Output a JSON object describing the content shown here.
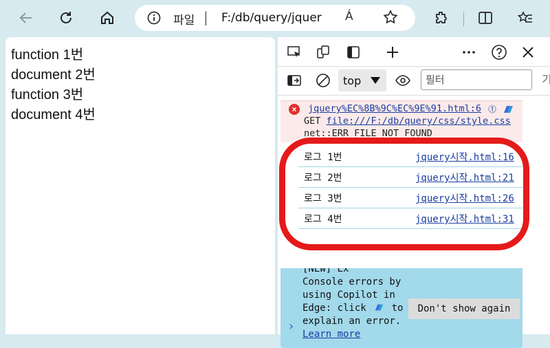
{
  "browser": {
    "address_site_label": "파일",
    "address_separator": "|",
    "address_url": "F:/db/query/jquer",
    "read_aloud_label": "Á"
  },
  "page": {
    "lines": [
      "function 1번",
      "document 2번",
      "function 3번",
      "document 4번"
    ]
  },
  "devtools": {
    "context": "top",
    "filter_placeholder": "필터",
    "more_hint": "기",
    "error": {
      "source": "jquery%EC%8B%9C%EC%9E%91.html:6",
      "badge": "⓵",
      "get_label": "GET",
      "get_url": "file:///F:/db/query/css/style.css",
      "status": "net::ERR_FILE_NOT_FOUND"
    },
    "logs": [
      {
        "msg": "로그 1번",
        "src": "jquery시작.html:16"
      },
      {
        "msg": "로그 2번",
        "src": "jquery시작.html:21"
      },
      {
        "msg": "로그 3번",
        "src": "jquery시작.html:26"
      },
      {
        "msg": "로그 4번",
        "src": "jquery시작.html:31"
      }
    ],
    "copilot": {
      "line1": "[NEW] Ex",
      "line2": "Console errors by",
      "line3": "using Copilot in",
      "line4a": "Edge: click",
      "line4b": "to",
      "line5": "explain an error.",
      "learn_more": "Learn more",
      "dont_show": "Don't show again"
    },
    "prompt": "›"
  },
  "colors": {
    "accent": "#1a3da0",
    "error_bg": "#fbeaea",
    "copilot_bg": "#a2d9eb",
    "annotation_red": "#e51a1a"
  }
}
